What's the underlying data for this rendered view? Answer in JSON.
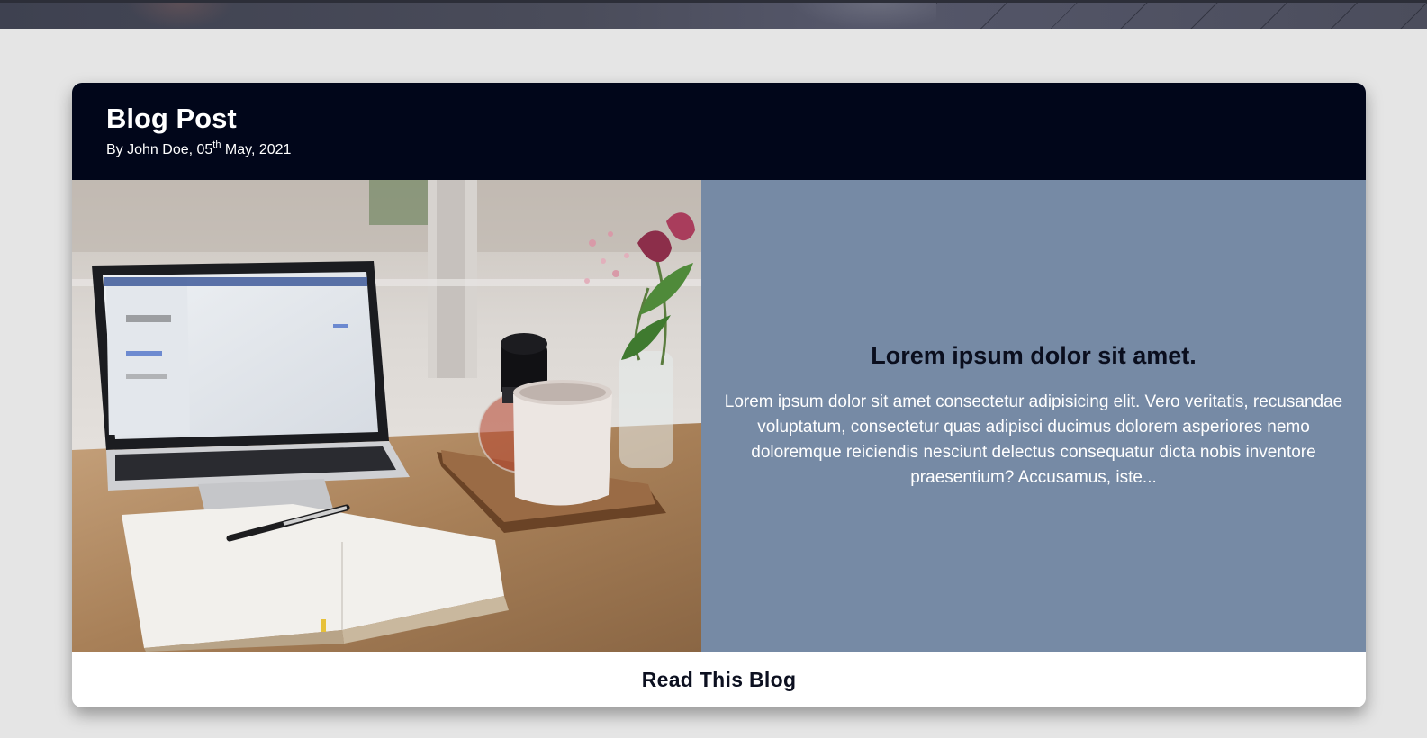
{
  "post": {
    "title": "Blog Post",
    "byline_prefix": "By John Doe, 05",
    "byline_sup": "th",
    "byline_suffix": " May, 2021",
    "heading": "Lorem ipsum dolor sit amet.",
    "excerpt": "Lorem ipsum dolor sit amet consectetur adipisicing elit. Vero veritatis, recusandae voluptatum, consectetur quas adipisci ducimus dolorem asperiores nemo doloremque reiciendis nesciunt delectus consequatur dicta nobis inventore praesentium? Accusamus, iste...",
    "read_label": "Read This Blog"
  },
  "colors": {
    "header_bg": "#01061a",
    "text_panel_bg": "#768aa5",
    "page_bg": "#e5e5e5",
    "heading_text": "#0a0e1e"
  }
}
